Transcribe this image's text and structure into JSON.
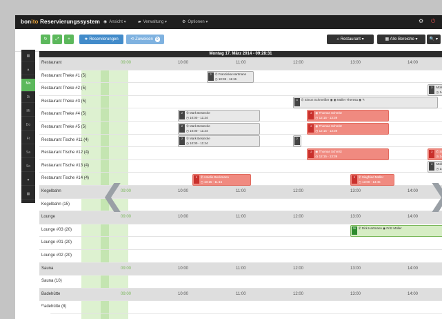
{
  "topbar": {
    "brand_pre": "bon",
    "brand_hl": "ito",
    "brand_post": " Reservierungssystem",
    "nav": [
      {
        "icon": "eye-icon",
        "glyph": "◉",
        "label": "Ansicht ▾"
      },
      {
        "icon": "folder-icon",
        "glyph": "▰",
        "label": "Verwaltung ▾"
      },
      {
        "icon": "gear-icon",
        "glyph": "⚙",
        "label": "Optionen ▾"
      }
    ],
    "right_icons": [
      {
        "icon": "settings-icon",
        "glyph": "⚙"
      },
      {
        "icon": "power-icon",
        "glyph": "⏻"
      }
    ]
  },
  "toolbar": {
    "left_buttons": [
      {
        "name": "refresh-button",
        "glyph": "↻",
        "color": "green"
      },
      {
        "name": "expand-button",
        "glyph": "⤢",
        "color": "green"
      },
      {
        "name": "add-button",
        "glyph": "+",
        "color": "green"
      },
      {
        "name": "new-reservation-button",
        "label": "★ Reservierungen",
        "color": "blue"
      },
      {
        "name": "waitlist-button",
        "label": "⟲ Zuweisen",
        "badge": "0",
        "color": "lblue"
      }
    ],
    "right_buttons": [
      {
        "name": "home-button",
        "label": "⌂ Restaurant ▾"
      },
      {
        "name": "filter-button",
        "label": "▦ Alle Bereiche ▾"
      },
      {
        "name": "search-button",
        "label": "🔍 ▾"
      }
    ]
  },
  "sidebar": {
    "items": [
      {
        "label": "▦"
      },
      {
        "label": "▲"
      },
      {
        "label": "Mo",
        "active": true
      },
      {
        "label": "Di"
      },
      {
        "label": "Mi"
      },
      {
        "label": "Do"
      },
      {
        "label": "Fr"
      },
      {
        "label": "Sa"
      },
      {
        "label": "So"
      },
      {
        "label": "▼"
      },
      {
        "label": "▦"
      }
    ]
  },
  "date_header": "Montag 17. März 2014 - 09:28:31",
  "time_ticks": [
    "09:00",
    "10:00",
    "11:00",
    "12:00",
    "13:00",
    "14:00"
  ],
  "rows": [
    {
      "label": "Restaurant",
      "group": true
    },
    {
      "label": "Restaurant Theke #1 (5)"
    },
    {
      "label": "Restaurant Theke #2 (5)"
    },
    {
      "label": "Restaurant Theke #3 (5)"
    },
    {
      "label": "Restaurant Theke #4 (5)"
    },
    {
      "label": "Restaurant Theke #5 (5)"
    },
    {
      "label": "Restaurant Tische #11 (4)"
    },
    {
      "label": "Restaurant Tische #12 (4)"
    },
    {
      "label": "Restaurant Tische #13 (4)"
    },
    {
      "label": "Restaurant Tische #14 (4)"
    },
    {
      "label": "Kegelbahn",
      "group": true
    },
    {
      "label": "Kegelbahn (15)"
    },
    {
      "label": "Lounge",
      "group": true
    },
    {
      "label": "Lounge #03 (20)"
    },
    {
      "label": "Lounge #01 (20)"
    },
    {
      "label": "Lounge #02 (20)"
    },
    {
      "label": "Sauna",
      "group": true
    },
    {
      "label": "Sauna (10)"
    },
    {
      "label": "Badehütte",
      "group": true
    },
    {
      "label": "Badehütte (8)"
    }
  ],
  "events": [
    {
      "row": 1,
      "start": 10.5,
      "end": 11.3,
      "style": "grey",
      "sq": "2",
      "line1": "✆ Franziska Hartmann",
      "line2": "◷ 10:35 - 11:15"
    },
    {
      "row": 2,
      "start": 14.35,
      "end": 14.7,
      "style": "grey",
      "sq": "2",
      "line1": "Müller T.",
      "line2": "◷ 14:30 -"
    },
    {
      "row": 3,
      "start": 12.0,
      "end": 14.5,
      "style": "grey",
      "sq": "4",
      "line1": "✆ Simon Schmeißer ◉ ◉ Müller Theresa ◉ ✎",
      "line2": ""
    },
    {
      "row": 4,
      "start": 10.0,
      "end": 11.4,
      "style": "grey",
      "sq": "2",
      "line1": "✆ Mark Bestecke",
      "line2": "◷ 10:00 - 11:24"
    },
    {
      "row": 4,
      "start": 12.25,
      "end": 13.65,
      "style": "red",
      "sq": "2",
      "line1": "◉ Thomas Schmitz",
      "line2": "◷ 12:15 - 13:39"
    },
    {
      "row": 5,
      "start": 10.0,
      "end": 11.4,
      "style": "grey",
      "sq": "2",
      "line1": "✆ Mark Bestecke",
      "line2": "◷ 10:00 - 11:24"
    },
    {
      "row": 5,
      "start": 12.25,
      "end": 13.65,
      "style": "red",
      "sq": "2",
      "line1": "◉ Thomas Schmitz",
      "line2": "◷ 12:15 - 13:39"
    },
    {
      "row": 6,
      "start": 10.0,
      "end": 11.4,
      "style": "grey",
      "sq": "2",
      "line1": "✆ Mark Bestecke",
      "line2": "◷ 10:00 - 11:24"
    },
    {
      "row": 6,
      "start": 12.0,
      "end": 12.1,
      "style": "grey",
      "sq": "2",
      "line1": "",
      "line2": ""
    },
    {
      "row": 7,
      "start": 12.25,
      "end": 13.65,
      "style": "red",
      "sq": "2",
      "line1": "◉ Thomas Schmitz",
      "line2": "◷ 12:15 - 13:39"
    },
    {
      "row": 7,
      "start": 14.35,
      "end": 14.95,
      "style": "red",
      "sq": "2",
      "line1": "✆ Siegfried Meier",
      "line2": "◷ 14:30 - 15:"
    },
    {
      "row": 8,
      "start": 14.35,
      "end": 14.7,
      "style": "grey",
      "sq": "2",
      "line1": "Müller T.",
      "line2": "◷ 14:30 -"
    },
    {
      "row": 9,
      "start": 10.25,
      "end": 11.25,
      "style": "red",
      "sq": "2",
      "line1": "✆ Amelie Beckmann",
      "line2": "◷ 10:15 - 11:15"
    },
    {
      "row": 9,
      "start": 13.0,
      "end": 13.75,
      "style": "red",
      "sq": "2",
      "line1": "✆ Siegfried Müller",
      "line2": "◷ 13:00 - 13:45"
    },
    {
      "row": 13,
      "start": 13.0,
      "end": 15.0,
      "style": "green",
      "sq": "20",
      "line1": "✆ Dirk Hartmann ◉ Fritz Müller",
      "line2": ""
    }
  ],
  "nav_arrows": {
    "left": "❮",
    "right": "❯"
  }
}
